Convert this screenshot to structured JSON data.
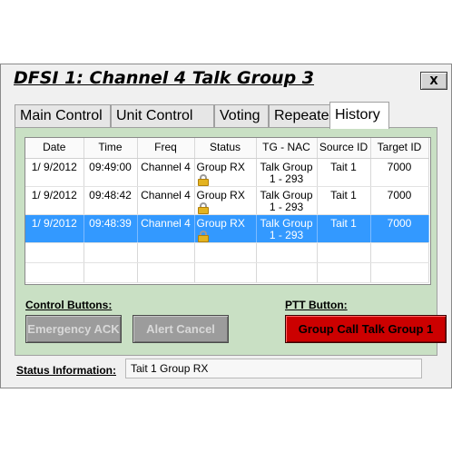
{
  "window": {
    "title": "DFSI 1: Channel 4 Talk Group 3",
    "close_label": "X"
  },
  "tabs": [
    {
      "label": "Main Control",
      "active": false
    },
    {
      "label": "Unit Control",
      "active": false
    },
    {
      "label": "Voting",
      "active": false
    },
    {
      "label": "Repeater",
      "active": false
    },
    {
      "label": "History",
      "active": true
    }
  ],
  "history": {
    "columns": [
      "Date",
      "Time",
      "Freq",
      "Status",
      "TG - NAC",
      "Source ID",
      "Target ID"
    ],
    "rows": [
      {
        "date": "1/ 9/2012",
        "time": "09:49:00",
        "freq": "Channel 4",
        "status": "Group RX",
        "status_icon": "lock-icon",
        "tg_nac": "Talk Group 1 - 293",
        "source_id": "Tait 1",
        "target_id": "7000",
        "selected": false
      },
      {
        "date": "1/ 9/2012",
        "time": "09:48:42",
        "freq": "Channel 4",
        "status": "Group RX",
        "status_icon": "lock-icon",
        "tg_nac": "Talk Group 1 - 293",
        "source_id": "Tait 1",
        "target_id": "7000",
        "selected": false
      },
      {
        "date": "1/ 9/2012",
        "time": "09:48:39",
        "freq": "Channel 4",
        "status": "Group RX",
        "status_icon": "lock-icon",
        "tg_nac": "Talk Group 1 - 293",
        "source_id": "Tait 1",
        "target_id": "7000",
        "selected": true
      }
    ]
  },
  "controls": {
    "label": "Control Buttons:",
    "emergency_ack": "Emergency ACK",
    "alert_cancel": "Alert Cancel"
  },
  "ptt": {
    "label": "PTT Button:",
    "button": "Group Call Talk Group 1"
  },
  "status": {
    "label": "Status Information:",
    "value": "Tait 1 Group RX"
  },
  "colors": {
    "panel_bg": "#c9e0c4",
    "selection": "#3399ff",
    "ptt_button": "#cc0000",
    "disabled_button": "#9c9c9c"
  }
}
